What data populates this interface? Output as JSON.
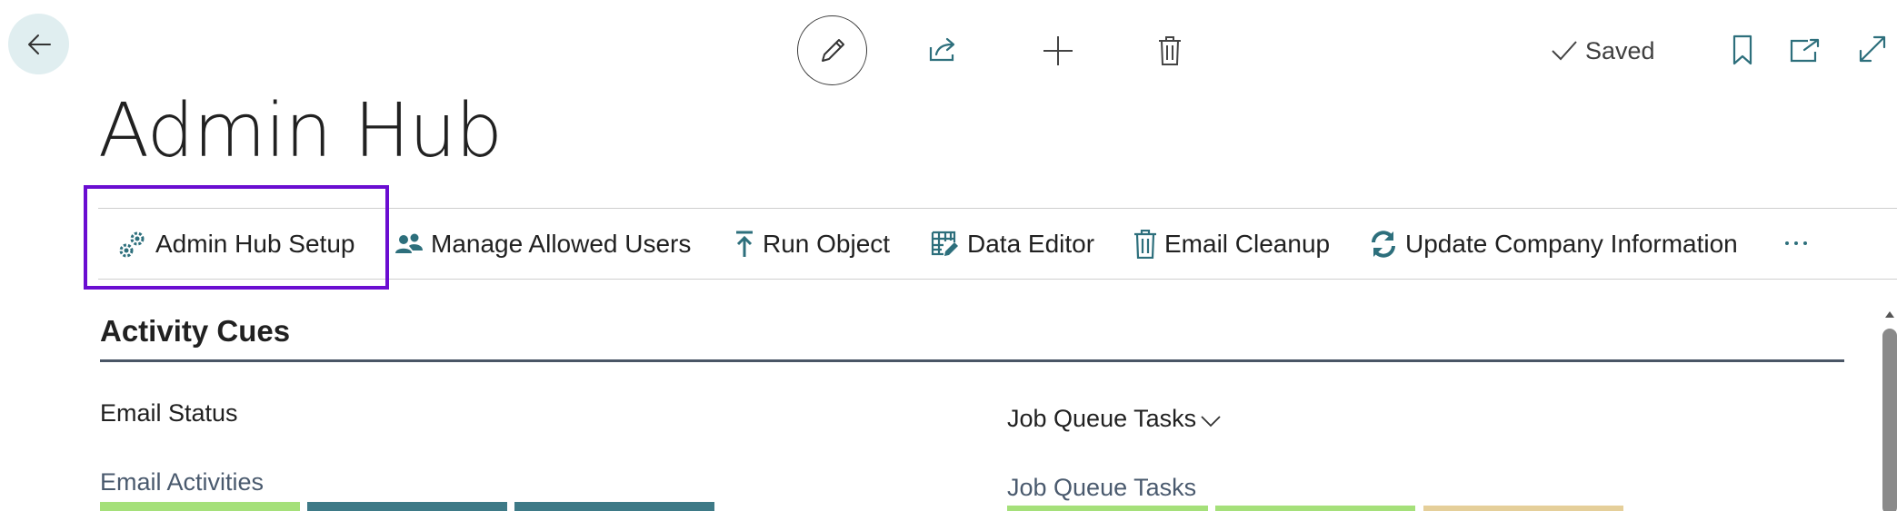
{
  "toolbar": {
    "saved_label": "Saved"
  },
  "page": {
    "title": "Admin Hub"
  },
  "actions": [
    {
      "label": "Admin Hub Setup",
      "icon": "gears-icon"
    },
    {
      "label": "Manage Allowed Users",
      "icon": "users-icon"
    },
    {
      "label": "Run Object",
      "icon": "upload-arrow-icon"
    },
    {
      "label": "Data Editor",
      "icon": "table-edit-icon"
    },
    {
      "label": "Email Cleanup",
      "icon": "trash-icon"
    },
    {
      "label": "Update Company Information",
      "icon": "refresh-icon"
    }
  ],
  "section": {
    "title": "Activity Cues",
    "email_status_label": "Email Status",
    "job_queue_group_label": "Job Queue Tasks",
    "email_activities_title": "Email Activities",
    "job_queue_tasks_title": "Job Queue Tasks"
  },
  "colors": {
    "accent": "#2d6f7c",
    "highlight_border": "#6a0dd1",
    "tile_green": "#a5e07a",
    "tile_teal": "#3e7a87",
    "tile_tan": "#e5cf9a"
  }
}
